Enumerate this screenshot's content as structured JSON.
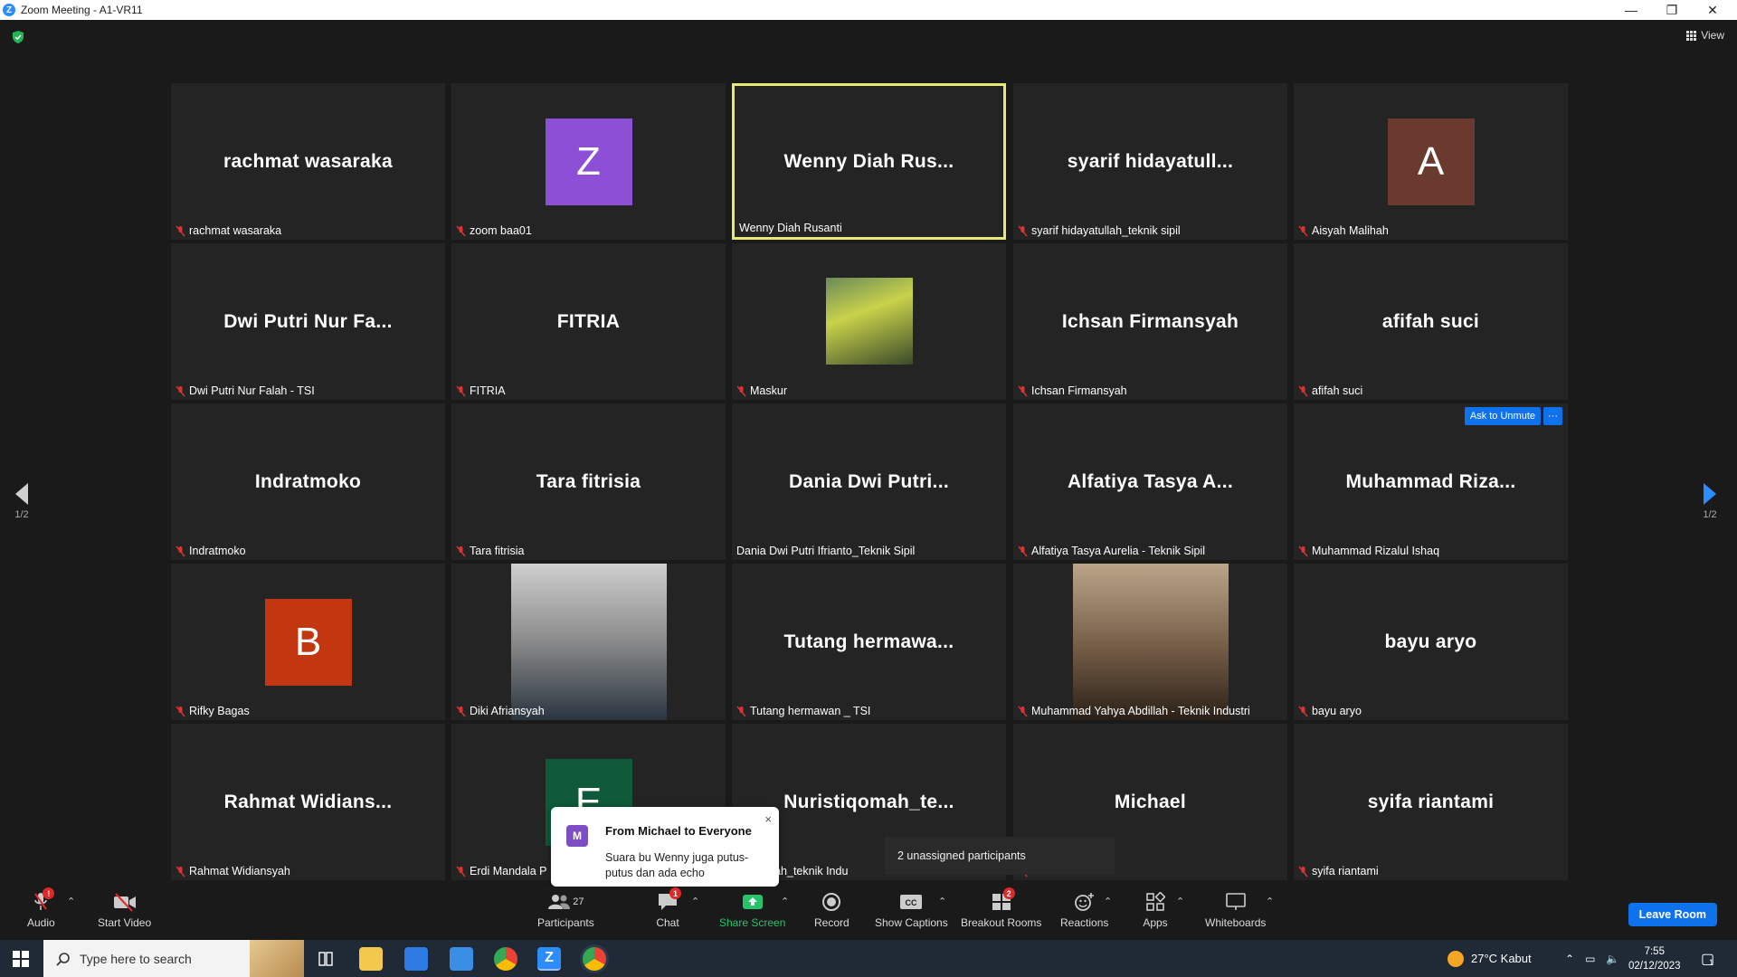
{
  "window": {
    "title": "Zoom Meeting - A1-VR11",
    "app_icon_letter": "Z"
  },
  "top": {
    "view_label": "View"
  },
  "tiles": [
    {
      "big": "rachmat wasaraka",
      "label": "rachmat wasaraka"
    },
    {
      "avatar": "Z",
      "avatar_color": "#8c4fd6",
      "label": "zoom baa01"
    },
    {
      "big": "Wenny Diah Rus...",
      "label": "Wenny Diah Rusanti"
    },
    {
      "big": "syarif hidayatull...",
      "label": "syarif hidayatullah_teknik sipil"
    },
    {
      "avatar": "A",
      "avatar_color": "#6a3a2e",
      "label": "Aisyah Malihah"
    },
    {
      "big": "Dwi Putri Nur Fa...",
      "label": "Dwi Putri Nur Falah - TSI"
    },
    {
      "big": "FITRIA",
      "label": "FITRIA"
    },
    {
      "photo": true,
      "label": "Maskur"
    },
    {
      "big": "Ichsan Firmansyah",
      "label": "Ichsan Firmansyah"
    },
    {
      "big": "afifah suci",
      "label": "afifah suci"
    },
    {
      "big": "Indratmoko",
      "label": "Indratmoko"
    },
    {
      "big": "Tara fitrisia",
      "label": "Tara fitrisia"
    },
    {
      "big": "Dania Dwi Putri...",
      "label": "Dania Dwi Putri Ifrianto_Teknik Sipil"
    },
    {
      "big": "Alfatiya Tasya A...",
      "label": "Alfatiya Tasya Aurelia - Teknik Sipil"
    },
    {
      "big": "Muhammad Riza...",
      "label": "Muhammad Rizalul Ishaq",
      "ask_unmute": "Ask to Unmute",
      "more": "···"
    },
    {
      "avatar": "B",
      "avatar_color": "#c2370f",
      "label": "Rifky Bagas"
    },
    {
      "photo": true,
      "label": "Diki Afriansyah"
    },
    {
      "big": "Tutang hermawa...",
      "label": "Tutang hermawan _ TSI"
    },
    {
      "photo": true,
      "label": "Muhammad Yahya Abdillah - Teknik Industri"
    },
    {
      "big": "bayu aryo",
      "label": "bayu aryo"
    },
    {
      "big": "Rahmat Widians...",
      "label": "Rahmat Widiansyah"
    },
    {
      "avatar": "E",
      "avatar_color": "#0e5a3a",
      "label": "Erdi Mandala P"
    },
    {
      "big": "Nuristiqomah_te...",
      "label": "iqomah_teknik Indu"
    },
    {
      "big": "Michael",
      "label": ""
    },
    {
      "big": "syifa riantami",
      "label": "syifa riantami"
    }
  ],
  "pager": {
    "left": "1/2",
    "right": "1/2"
  },
  "chat_popup": {
    "avatar": "M",
    "from": "From Michael to Everyone",
    "message": "Suara bu Wenny juga putus-putus dan ada echo",
    "close": "×"
  },
  "unassigned": "2 unassigned participants",
  "toolbar": {
    "audio": "Audio",
    "start_video": "Start Video",
    "participants": "Participants",
    "participants_count": "27",
    "chat": "Chat",
    "chat_badge": "1",
    "share_screen": "Share Screen",
    "record": "Record",
    "show_captions": "Show Captions",
    "breakout_rooms": "Breakout Rooms",
    "breakout_badge": "2",
    "reactions": "Reactions",
    "apps": "Apps",
    "whiteboards": "Whiteboards",
    "leave": "Leave Room",
    "audio_badge": "!"
  },
  "taskbar": {
    "search_placeholder": "Type here to search",
    "weather": "27°C  Kabut",
    "time": "7:55",
    "date": "02/12/2023",
    "notif_count": "1"
  },
  "colors": {
    "accent": "#0e72ed",
    "active_border": "#e8e878",
    "share_green": "#26c36b",
    "muted_red": "#e02828"
  }
}
